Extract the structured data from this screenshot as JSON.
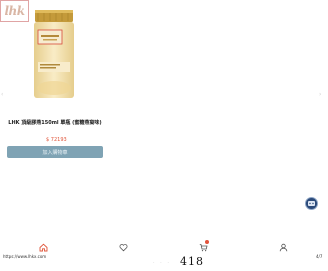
{
  "brand": {
    "logo_text": "lhk"
  },
  "product": {
    "title": "LHK 頂級膠燕150ml 單瓶 (蜜糖燕窩味)",
    "price": "$ 72193",
    "add_to_cart_label": "加入購物車"
  },
  "footer": {
    "url": "https://www.lhkx.com",
    "page_number": "4/7",
    "bottom_number": "418"
  },
  "colors": {
    "accent_button": "#7fa3b4",
    "price": "#e0553a",
    "home_icon": "#e0553a",
    "badge": "#e2533c"
  },
  "icons": [
    "home-icon",
    "heart-icon",
    "cart-icon",
    "user-icon",
    "assistant-icon"
  ]
}
